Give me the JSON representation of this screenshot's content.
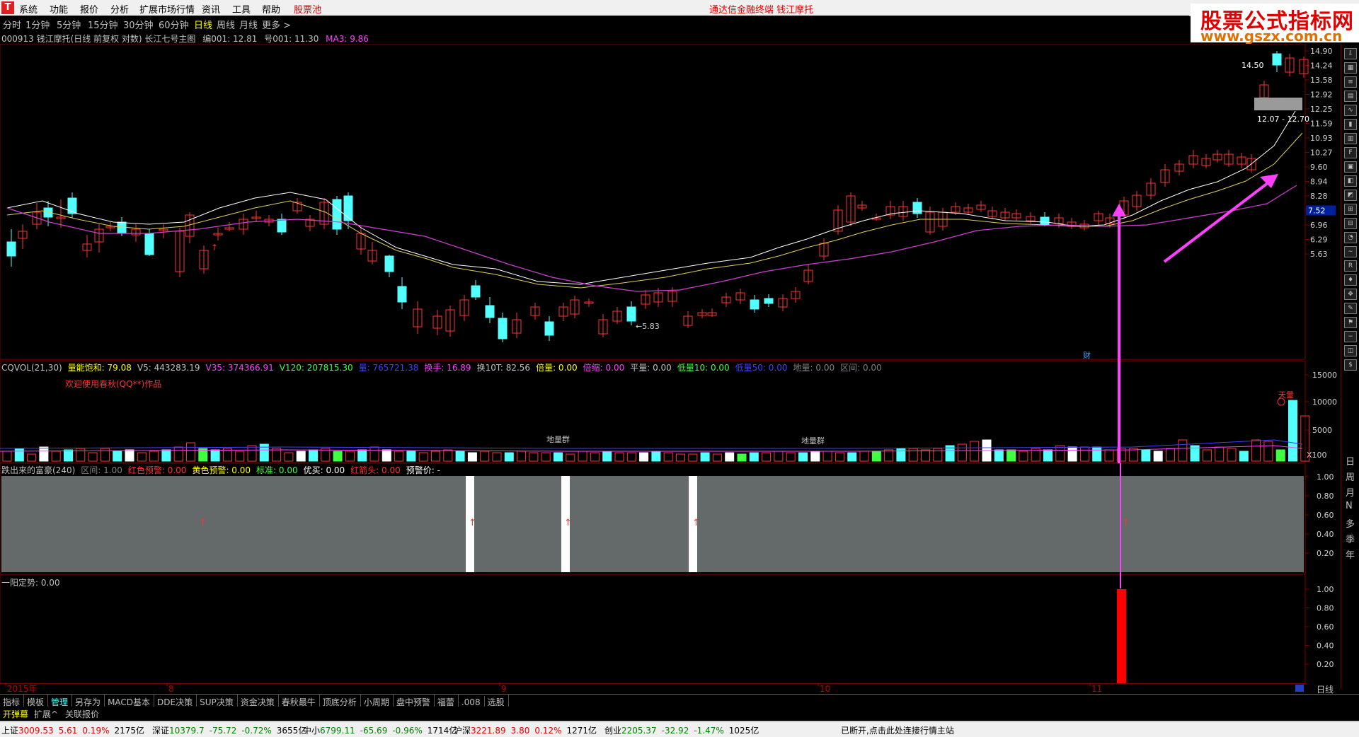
{
  "menubar": {
    "items": [
      "系统",
      "功能",
      "报价",
      "分析",
      "扩展市场行情",
      "资讯",
      "工具",
      "帮助",
      "股票池"
    ],
    "title": "通达信金融终端    钱江摩托"
  },
  "tabs": [
    "分时",
    "1分钟",
    "5分钟",
    "15分钟",
    "30分钟",
    "60分钟",
    "日线",
    "周线",
    "月线",
    "更多 >"
  ],
  "active_tab": "日线",
  "brand": {
    "line1": "股票公式指标网",
    "line2": "www.gszx.com.cn"
  },
  "info": {
    "code_name": "000913 钱江摩托(日线 前复权 对数) 长江七号主图",
    "bian": "编001: 12.81",
    "hao": "号001: 11.30",
    "ma3": "MA3: 9.86"
  },
  "main_chart": {
    "y_ticks": [
      "14.90",
      "14.24",
      "13.58",
      "12.92",
      "12.25",
      "11.59",
      "10.93",
      "10.27",
      "9.60",
      "8.94",
      "8.28",
      "7.52",
      "6.96",
      "6.29",
      "5.63"
    ],
    "current_price": "7.52",
    "labels": {
      "high": "14.50",
      "low": "5.83",
      "range": "12.07 - 12.70",
      "cai": "财"
    },
    "colors": {
      "up": "#ff3232",
      "down": "#54ffff",
      "ma_fast": "#ffffff",
      "ma_mid": "#e0d060",
      "ma_slow": "#d040d0",
      "arrow": "#ff40ff"
    }
  },
  "vol_panel": {
    "header": [
      {
        "t": "CQVOL(21,30)",
        "c": "#c0c0c0"
      },
      {
        "t": "量能饱和: 79.08",
        "c": "#ffff00"
      },
      {
        "t": "V5: 443283.19",
        "c": "#c0c0c0"
      },
      {
        "t": "V35: 374366.91",
        "c": "#ff40ff"
      },
      {
        "t": "V120: 207815.30",
        "c": "#40ff40"
      },
      {
        "t": "量: 765721.38",
        "c": "#4040ff"
      },
      {
        "t": "换手: 16.89",
        "c": "#ff40ff"
      },
      {
        "t": "换10T: 82.56",
        "c": "#c0c0c0"
      },
      {
        "t": "倍量: 0.00",
        "c": "#ffff00"
      },
      {
        "t": "倍缩: 0.00",
        "c": "#ff40ff"
      },
      {
        "t": "平量: 0.00",
        "c": "#c0c0c0"
      },
      {
        "t": "低量10: 0.00",
        "c": "#40ff40"
      },
      {
        "t": "低量50: 0.00",
        "c": "#4040ff"
      },
      {
        "t": "地量: 0.00",
        "c": "#808080"
      },
      {
        "t": "区间: 0.00",
        "c": "#808080"
      }
    ],
    "welcome": "欢迎使用春秋(QQ**)作品",
    "tags": [
      "地量群",
      "地量群",
      "天量"
    ],
    "y_ticks": [
      "15000",
      "10000",
      "5000",
      "X100"
    ]
  },
  "signal_panel": {
    "header": [
      {
        "t": "跌出来的富豪(240)",
        "c": "#c0c0c0"
      },
      {
        "t": "区间: 1.00",
        "c": "#808080"
      },
      {
        "t": "红色预警: 0.00",
        "c": "#ff3232"
      },
      {
        "t": "黄色预警: 0.00",
        "c": "#ffff00"
      },
      {
        "t": "标准: 0.00",
        "c": "#40ff40"
      },
      {
        "t": "优买: 0.00",
        "c": "#ffffff"
      },
      {
        "t": "红箭头: 0.00",
        "c": "#ff3232"
      },
      {
        "t": "预警价: -",
        "c": "#ffffff"
      }
    ],
    "y_ticks": [
      "1.00",
      "0.80",
      "0.60",
      "0.40",
      "0.20"
    ]
  },
  "trend_panel": {
    "header": "一阳定势: 0.00",
    "y_ticks": [
      "1.00",
      "0.80",
      "0.60",
      "0.40",
      "0.20"
    ]
  },
  "x_axis": {
    "labels": [
      "2015年",
      "8",
      "9",
      "10",
      "11"
    ],
    "period": "日线"
  },
  "bottom_tabs": [
    "指标",
    "模板",
    "管理",
    "另存为",
    "MACD基本",
    "DDE决策",
    "SUP决策",
    "资金决策",
    "春秋最牛",
    "顶底分析",
    "小周期",
    "盘中预警",
    "福蕾",
    ".008",
    "选股"
  ],
  "bottom_tabs2": [
    "开弹幕",
    "扩展^",
    "关联报价"
  ],
  "sidebar_chars": [
    "日",
    "周",
    "月",
    "N",
    "多",
    "季",
    "年"
  ],
  "statusbar": [
    {
      "name": "上证",
      "v": "3009.53",
      "d": "5.61",
      "p": "0.19%",
      "a": "2175亿",
      "color": "#e00000"
    },
    {
      "name": "深证",
      "v": "10379.7",
      "d": "-75.72",
      "p": "-0.72%",
      "a": "3655亿",
      "color": "#008000"
    },
    {
      "name": "中小",
      "v": "6799.11",
      "d": "-65.69",
      "p": "-0.96%",
      "a": "1714亿",
      "color": "#008000"
    },
    {
      "name": "沪深",
      "v": "3221.89",
      "d": "3.80",
      "p": "0.12%",
      "a": "1271亿",
      "color": "#e00000"
    },
    {
      "name": "创业",
      "v": "2205.37",
      "d": "-32.92",
      "p": "-1.47%",
      "a": "1025亿",
      "color": "#008000"
    }
  ],
  "status_msg": "已断开,点击此处连接行情主站"
}
